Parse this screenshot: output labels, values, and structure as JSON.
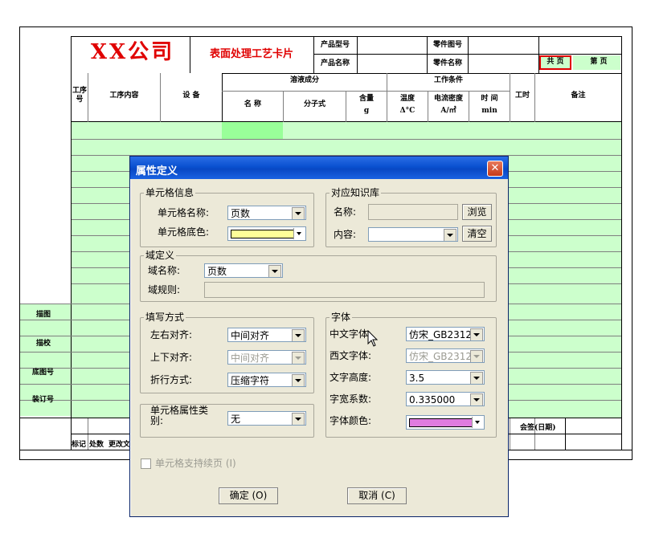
{
  "sheet": {
    "company": "XX公司",
    "card_title": "表面处理工艺卡片",
    "product_code_label": "产品型号",
    "product_name_label": "产品名称",
    "part_code_label": "零件图号",
    "part_name_label": "零件名称",
    "total_pages_label": "共 页",
    "page_no_label": "第 页",
    "col_step": "工序号",
    "col_content": "工序内容",
    "col_equipment": "设 备",
    "col_solution": "溶液成分",
    "col_name": "名 称",
    "col_formula": "分子式",
    "col_amount": "含量",
    "col_amount_unit": "g",
    "col_conditions": "工作条件",
    "col_temp": "温度",
    "col_temp_unit": "Δ°C",
    "col_current": "电流密度",
    "col_current_unit": "A/㎡",
    "col_time": "时 间",
    "col_time_unit": "min",
    "col_hours": "工时",
    "col_remarks": "备注",
    "side_labels": [
      "描图",
      "描校",
      "底图号",
      "装订号"
    ],
    "footer_labels": [
      "标记",
      "处数",
      "更改文件"
    ],
    "sign_label": "会签(日期)"
  },
  "dialog": {
    "title": "属性定义",
    "cell_info": {
      "group": "单元格信息",
      "name_label": "单元格名称:",
      "name_value": "页数",
      "color_label": "单元格底色:",
      "color": "#ffff99"
    },
    "knowledge": {
      "group": "对应知识库",
      "name_label": "名称:",
      "browse": "浏览",
      "content_label": "内容:",
      "clear": "清空"
    },
    "domain": {
      "group": "域定义",
      "name_label": "域名称:",
      "name_value": "页数",
      "rule_label": "域规则:"
    },
    "fill": {
      "group": "填写方式",
      "halign_label": "左右对齐:",
      "halign_value": "中间对齐",
      "valign_label": "上下对齐:",
      "valign_value": "中间对齐",
      "wrap_label": "折行方式:",
      "wrap_value": "压缩字符"
    },
    "celltype": {
      "label": "单元格属性类别:",
      "value": "无"
    },
    "font": {
      "group": "字体",
      "cn_label": "中文字体:",
      "cn_value": "仿宋_GB2312",
      "en_label": "西文字体:",
      "en_value": "仿宋_GB2312",
      "height_label": "文字高度:",
      "height_value": "3.5",
      "width_label": "字宽系数:",
      "width_value": "0.335000",
      "color_label": "字体颜色:",
      "color": "#e07ce0"
    },
    "continue_label": "单元格支持续页 (I)",
    "ok": "确定 (O)",
    "cancel": "取消 (C)"
  }
}
